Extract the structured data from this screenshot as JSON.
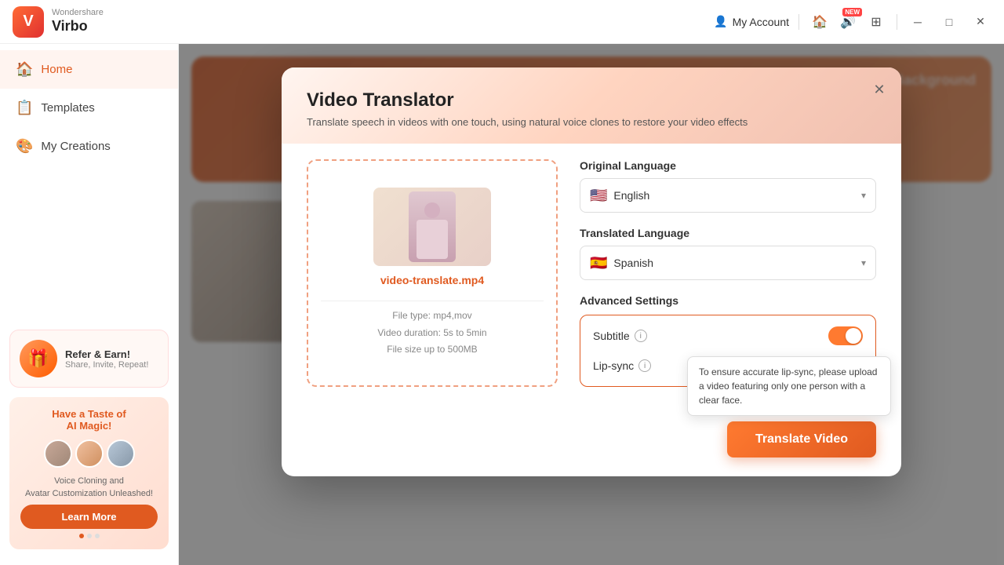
{
  "app": {
    "name_top": "Wondershare",
    "name_bottom": "Virbo"
  },
  "titlebar": {
    "my_account": "My Account",
    "new_badge": "NEW"
  },
  "sidebar": {
    "items": [
      {
        "id": "home",
        "label": "Home",
        "active": true
      },
      {
        "id": "templates",
        "label": "Templates",
        "active": false
      },
      {
        "id": "my-creations",
        "label": "My Creations",
        "active": false
      }
    ],
    "refer": {
      "title": "Refer & Earn!",
      "subtitle": "Share, Invite, Repeat!"
    },
    "ai_magic": {
      "heading1": "Have a Taste of",
      "heading2": "AI Magic!",
      "description": "Voice Cloning and\nAvatar Customization Unleashed!",
      "learn_more": "Learn More"
    }
  },
  "modal": {
    "title": "Video Translator",
    "subtitle": "Translate speech in videos with one touch, using natural voice clones to restore your video effects",
    "original_language_label": "Original Language",
    "original_language_value": "English",
    "original_language_flag": "🇺🇸",
    "translated_language_label": "Translated Language",
    "translated_language_value": "Spanish",
    "translated_language_flag": "🇪🇸",
    "advanced_settings_label": "Advanced Settings",
    "subtitle_label": "Subtitle",
    "lipsync_label": "Lip-sync",
    "tooltip_text": "To ensure accurate lip-sync, please upload a video featuring only one person with a clear face.",
    "translate_button": "Translate Video",
    "video": {
      "filename": "video-translate.mp4",
      "file_type_label": "File type: mp4,mov",
      "duration_label": "Video duration: 5s to 5min",
      "size_label": "File size up to  500MB"
    }
  },
  "background": {
    "transparent_bg_label": "Transparent Background"
  }
}
